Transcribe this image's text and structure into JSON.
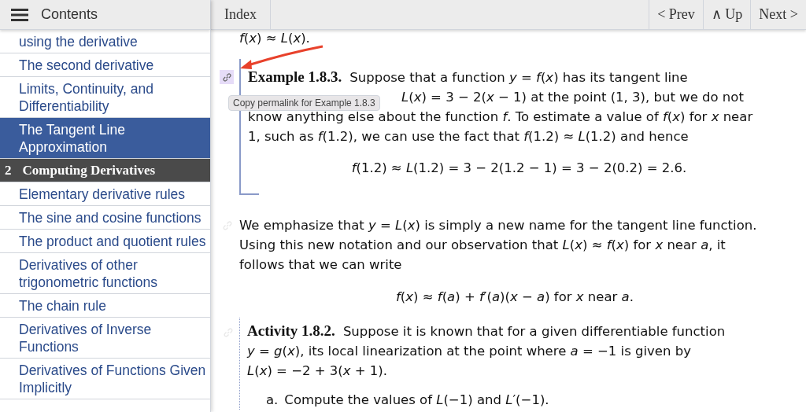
{
  "sidebar": {
    "title": "Contents",
    "items": [
      {
        "kind": "section",
        "label": "using the derivative",
        "selected": false
      },
      {
        "kind": "section",
        "label": "The second derivative",
        "selected": false
      },
      {
        "kind": "section",
        "label": "Limits, Continuity, and Differentiability",
        "selected": false
      },
      {
        "kind": "section",
        "label": "The Tangent Line Approximation",
        "selected": true
      },
      {
        "kind": "chapter",
        "number": "2",
        "label": "Computing Derivatives",
        "selected": false
      },
      {
        "kind": "section",
        "label": "Elementary derivative rules",
        "selected": false
      },
      {
        "kind": "section",
        "label": "The sine and cosine functions",
        "selected": false
      },
      {
        "kind": "section",
        "label": "The product and quotient rules",
        "selected": false
      },
      {
        "kind": "section",
        "label": "Derivatives of other trigonometric functions",
        "selected": false
      },
      {
        "kind": "section",
        "label": "The chain rule",
        "selected": false
      },
      {
        "kind": "section",
        "label": "Derivatives of Inverse Functions",
        "selected": false
      },
      {
        "kind": "section",
        "label": "Derivatives of Functions Given Implicitly",
        "selected": false
      }
    ]
  },
  "toolbar": {
    "index": "Index",
    "nav": [
      {
        "label": "< Prev"
      },
      {
        "label": "∧ Up"
      },
      {
        "label": "Next >"
      }
    ]
  },
  "content": [
    {
      "kind": "display",
      "text": "*f*(*x*) ≈ *L*(*x*)."
    },
    {
      "kind": "example",
      "heading": "Example 1.8.3.",
      "tooltip": "Copy permalink for Example 1.8.3",
      "lines": [
        "Suppose that a function *y* = *f*(*x*) has its tangent line",
        "*L*(*x*) = 3 − 2(*x* − 1) at the point (1, 3), but we do not",
        "know anything else about the function *f*. To estimate a value of *f*(*x*) for *x* near",
        "1, such as *f*(1.2), we can use the fact that *f*(1.2) ≈ *L*(1.2) and hence"
      ],
      "display": "*f*(1.2) ≈ *L*(1.2) = 3 − 2(1.2 − 1) = 3 − 2(0.2) = 2.6."
    },
    {
      "kind": "paragraph",
      "lines": [
        "We emphasize that *y* = *L*(*x*) is simply a new name for the tangent line function.",
        "Using this new notation and our observation that *L*(*x*) ≈ *f*(*x*) for *x* near *a*, it",
        "follows that we can write"
      ],
      "display": "*f*(*x*) ≈ *f*(*a*) + *f*′(*a*)(*x* − *a*) for *x* near *a*."
    },
    {
      "kind": "activity",
      "heading": "Activity 1.8.2.",
      "lines": [
        "Suppose it is known that for a given differentiable function",
        "*y* = *g*(*x*), its local linearization at the point where *a* = −1 is given by",
        "*L*(*x*) = −2 + 3(*x* + 1)."
      ],
      "list": [
        {
          "marker": "a.",
          "text": "Compute the values of *L*(−1) and *L*′(−1)."
        }
      ]
    }
  ]
}
